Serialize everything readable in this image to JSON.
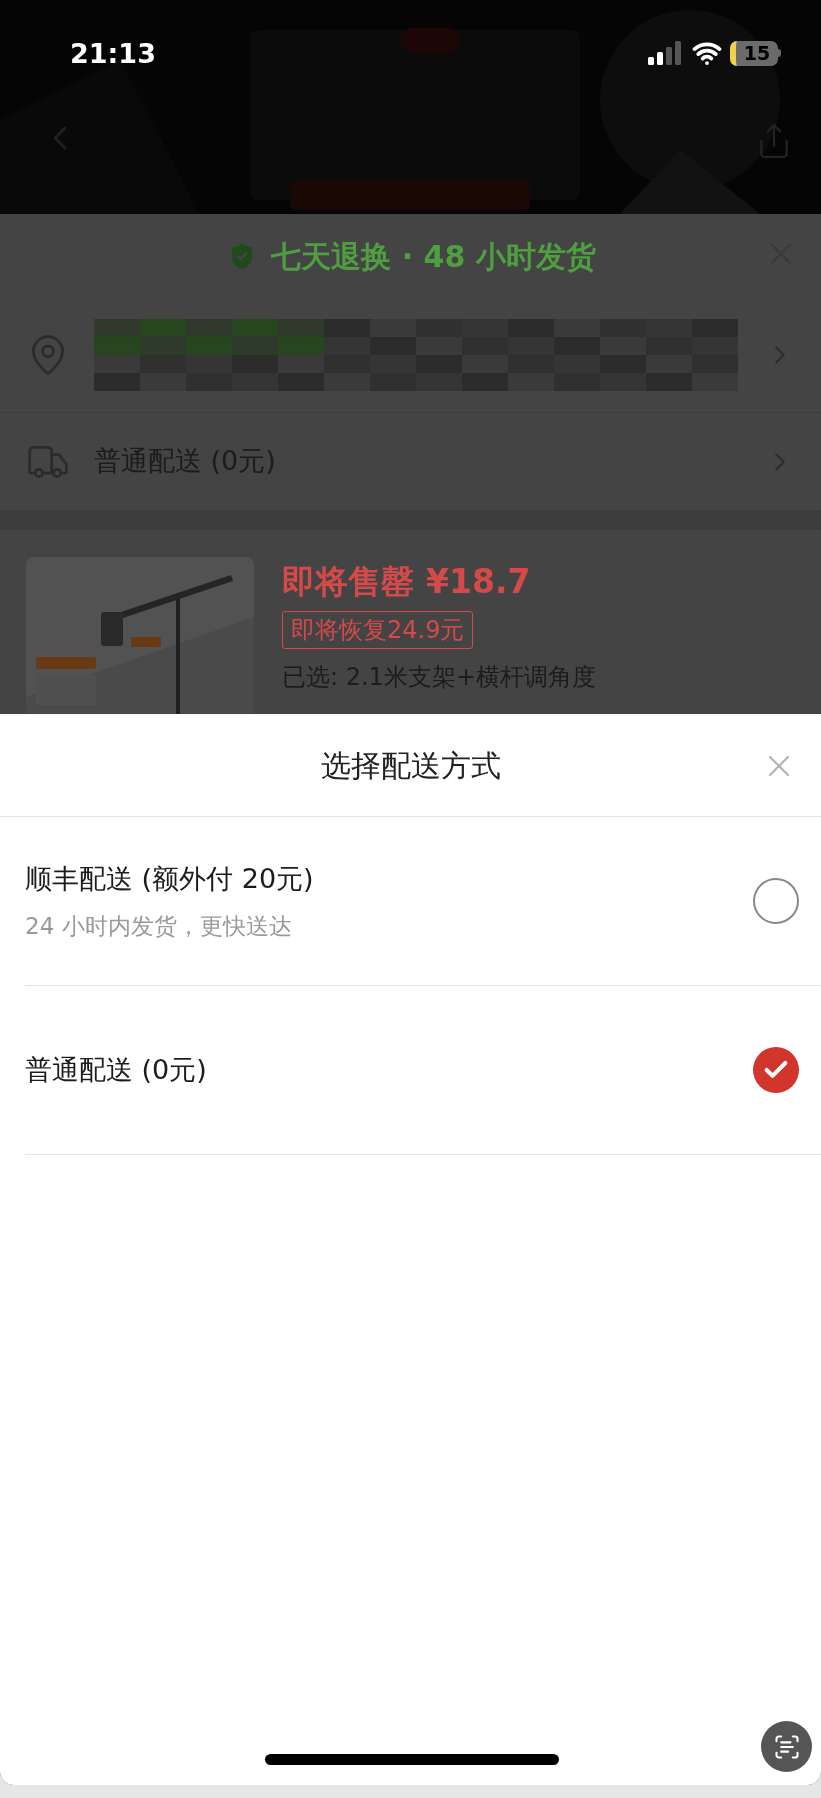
{
  "status_bar": {
    "time": "21:13",
    "battery": "15"
  },
  "guarantee": {
    "text": "七天退换 · 48 小时发货"
  },
  "shipping_row": {
    "label": "普通配送 (0元)"
  },
  "product": {
    "status": "即将售罄",
    "price": "¥18.7",
    "restore_badge": "即将恢复24.9元",
    "chosen": "已选: 2.1米支架+横杆调角度"
  },
  "sheet": {
    "title": "选择配送方式",
    "options": [
      {
        "label": "顺丰配送 (额外付 20元)",
        "note": "24 小时内发货，更快送达",
        "selected": false
      },
      {
        "label": "普通配送 (0元)",
        "selected": true
      }
    ]
  }
}
